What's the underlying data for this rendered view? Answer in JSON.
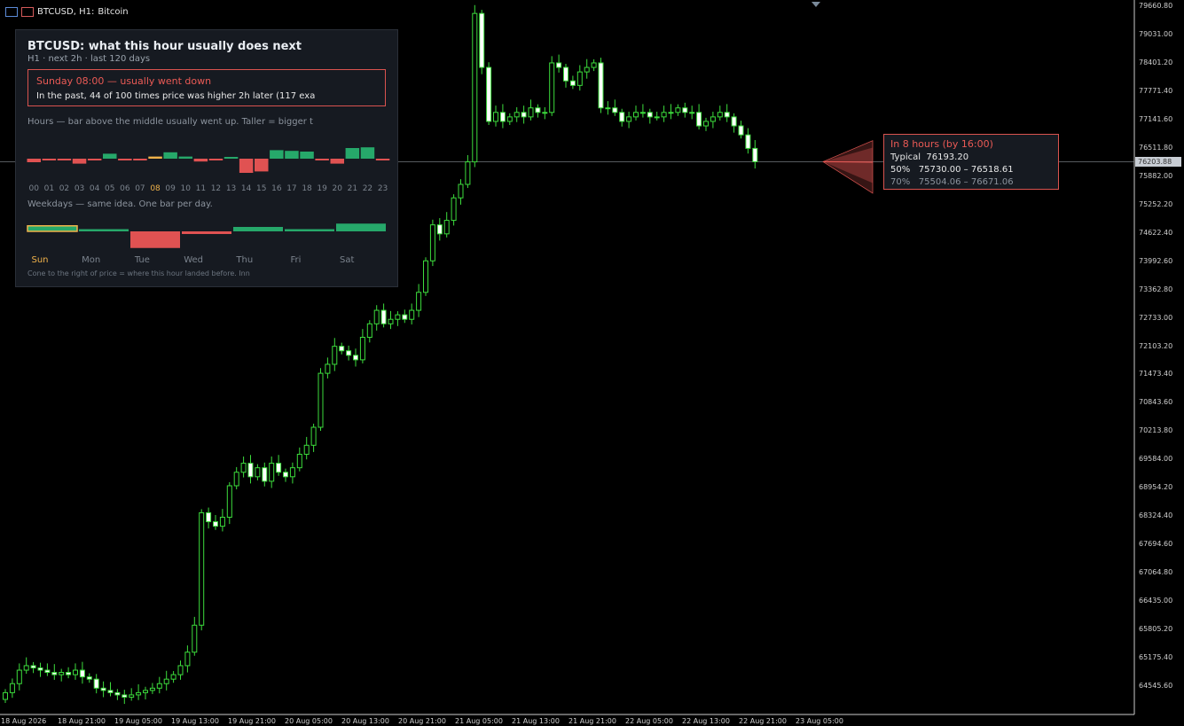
{
  "window": {
    "symbol_title": "BTCUSD, H1:",
    "description": "Bitcoin"
  },
  "panel": {
    "title": "BTCUSD: what this hour usually does next",
    "subtitle_parts": [
      "H1",
      "next 2h",
      "last 120 days"
    ],
    "alert_title": "Sunday 08:00 — usually went down",
    "alert_text": "In the past, 44 of 100 times price was higher 2h later (117 exa",
    "hours_caption": "Hours — bar above the middle usually went up. Taller = bigger t",
    "weekday_caption": "Weekdays — same idea. One bar per day.",
    "footer": "Cone to the right of price = where this hour landed before. Inn",
    "hour_labels": [
      "00",
      "01",
      "02",
      "03",
      "04",
      "05",
      "06",
      "07",
      "08",
      "09",
      "10",
      "11",
      "12",
      "13",
      "14",
      "15",
      "16",
      "17",
      "18",
      "19",
      "20",
      "21",
      "22",
      "23"
    ],
    "hour_values": [
      -0.25,
      -0.05,
      -0.05,
      -0.35,
      -0.12,
      0.35,
      -0.12,
      -0.12,
      0.15,
      0.45,
      0.15,
      -0.2,
      -0.05,
      0.1,
      -1.0,
      -0.9,
      0.6,
      0.55,
      0.5,
      -0.12,
      -0.35,
      0.75,
      0.8,
      -0.1
    ],
    "selected_hour": 8,
    "day_labels": [
      "Sun",
      "Mon",
      "Tue",
      "Wed",
      "Thu",
      "Fri",
      "Sat"
    ],
    "day_values": [
      0.25,
      0.1,
      -0.75,
      -0.12,
      0.2,
      0.1,
      0.35
    ],
    "selected_day": 0,
    "colors": {
      "up": "#26a86a",
      "down": "#e05252",
      "selected": "#f0b24a"
    }
  },
  "forecast": {
    "title": "In 8 hours  (by 16:00)",
    "typical_label": "Typical",
    "typical_value": "76193.20",
    "band50_label": "50%",
    "band50_value": "75730.00 – 76518.61",
    "band70_label": "70%",
    "band70_value": "75504.06 – 76671.06",
    "typical_num": 76193.2,
    "band50": [
      75730.0,
      76518.61
    ],
    "band70": [
      75504.06,
      76671.06
    ]
  },
  "price_scale": {
    "labels": [
      "79660.80",
      "79031.00",
      "78401.20",
      "77771.40",
      "77141.60",
      "76511.80",
      "75882.00",
      "75252.20",
      "74622.40",
      "73992.60",
      "73362.80",
      "72733.00",
      "72103.20",
      "71473.40",
      "70843.60",
      "70213.80",
      "69584.00",
      "68954.20",
      "68324.40",
      "67694.60",
      "67064.80",
      "66435.00",
      "65805.20",
      "65175.40",
      "64545.60"
    ],
    "current_price": "76203.88",
    "current_num": 76203.88,
    "range": [
      64545.6,
      79660.8
    ]
  },
  "time_axis": {
    "labels": [
      "18 Aug 2026",
      "18 Aug 21:00",
      "19 Aug 05:00",
      "19 Aug 13:00",
      "19 Aug 21:00",
      "20 Aug 05:00",
      "20 Aug 13:00",
      "20 Aug 21:00",
      "21 Aug 05:00",
      "21 Aug 13:00",
      "21 Aug 21:00",
      "22 Aug 05:00",
      "22 Aug 13:00",
      "22 Aug 21:00",
      "23 Aug 05:00"
    ]
  },
  "chart_data": {
    "type": "candlestick",
    "series_close": [
      64400,
      64600,
      64900,
      65000,
      64950,
      64900,
      64850,
      64800,
      64850,
      64800,
      64900,
      64750,
      64700,
      64500,
      64450,
      64400,
      64350,
      64300,
      64350,
      64400,
      64450,
      64500,
      64600,
      64700,
      64800,
      65000,
      65300,
      65900,
      68400,
      68200,
      68100,
      68300,
      69000,
      69300,
      69500,
      69200,
      69400,
      69100,
      69500,
      69300,
      69200,
      69400,
      69700,
      69900,
      70300,
      71500,
      71700,
      72100,
      72000,
      71900,
      71800,
      72300,
      72600,
      72900,
      72600,
      72700,
      72800,
      72700,
      72900,
      73300,
      74000,
      74800,
      74600,
      74900,
      75400,
      75700,
      76200,
      79500,
      78300,
      77100,
      77300,
      77100,
      77200,
      77300,
      77200,
      77400,
      77300,
      77300,
      78400,
      78300,
      78000,
      77900,
      78200,
      78300,
      78400,
      77400,
      77400,
      77300,
      77100,
      77200,
      77300,
      77300,
      77200,
      77200,
      77300,
      77300,
      77400,
      77300,
      77300,
      77000,
      77100,
      77200,
      77300,
      77200,
      77000,
      76800,
      76500,
      76203
    ]
  }
}
